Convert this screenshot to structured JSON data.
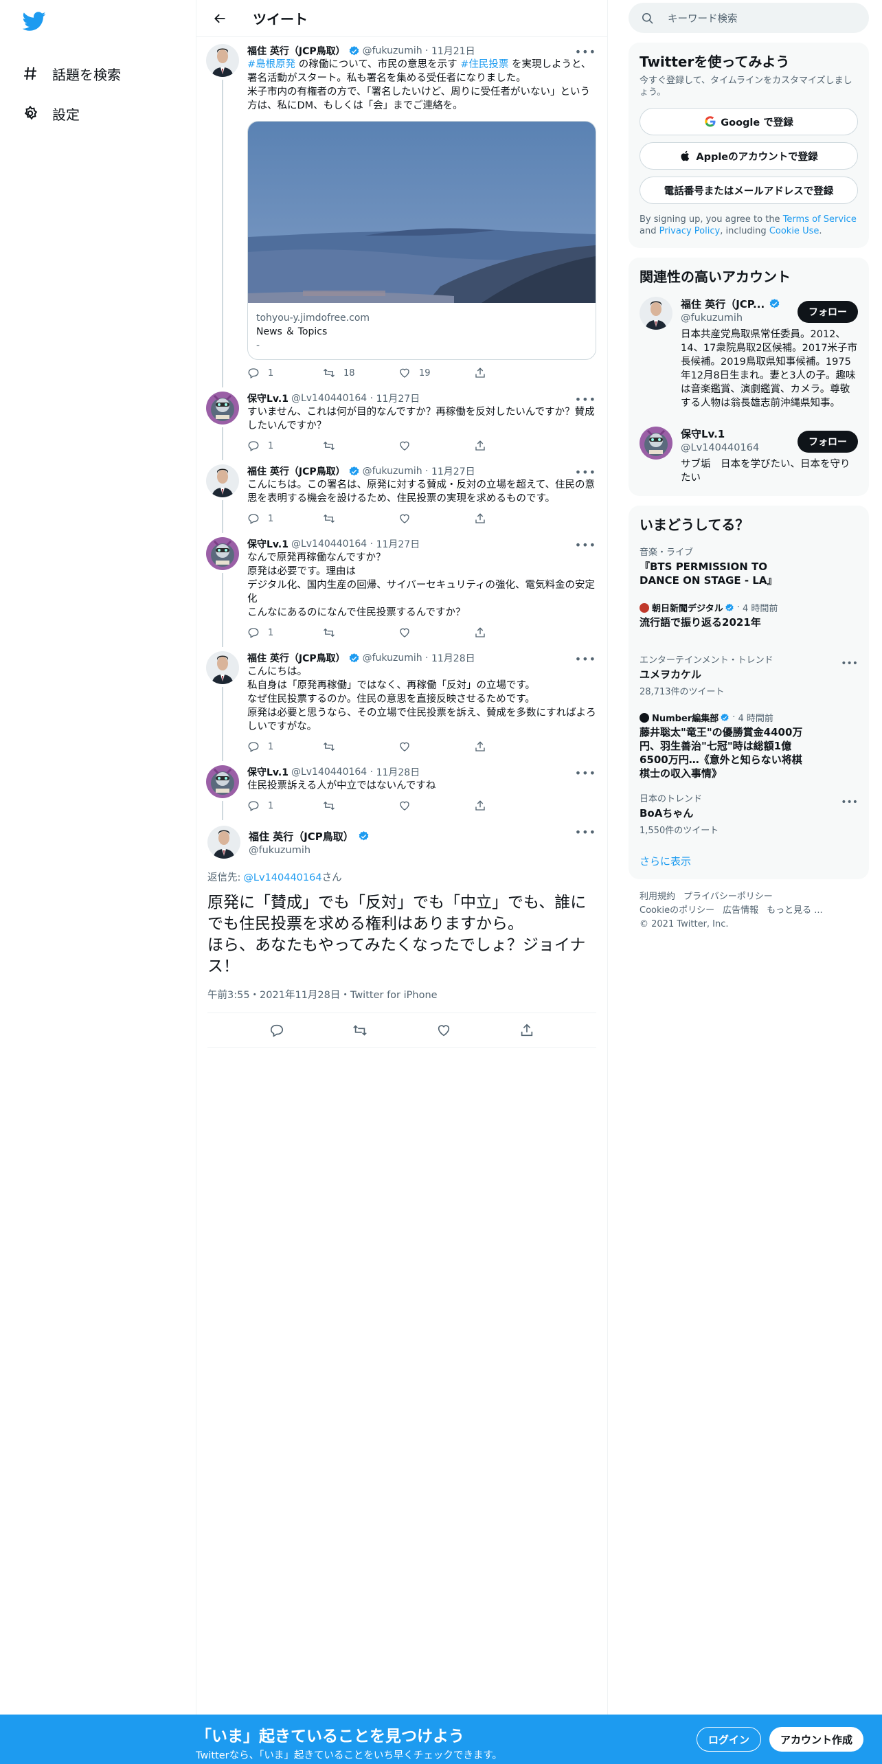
{
  "nav": {
    "explore_label": "話題を検索",
    "settings_label": "設定"
  },
  "header": {
    "title": "ツイート"
  },
  "tweets": [
    {
      "name": "福住 英行（JCP鳥取）",
      "verified": true,
      "handle": "@fukuzumih",
      "date": "11月21日",
      "hashtag1": "#島根原発",
      "text_a": " の稼働について、市民の意思を示す ",
      "hashtag2": "#住民投票",
      "text_b": " を実現しようと、署名活動がスタート。私も署名を集める受任者になりました。\n米子市内の有権者の方で、「署名したいけど、周りに受任者がいない」という方は、私にDM、もしくは「会」までご連絡を。",
      "card_domain": "tohyou-y.jimdofree.com",
      "card_title": "News ＆ Topics",
      "card_desc": "-",
      "replies": "1",
      "retweets": "18",
      "likes": "19"
    },
    {
      "name": "保守Lv.1",
      "handle": "@Lv140440164",
      "date": "11月27日",
      "text": "すいません、これは何が目的なんですか？再稼働を反対したいんですか？賛成したいんですか？",
      "replies": "1"
    },
    {
      "name": "福住 英行（JCP鳥取）",
      "handle": "@fukuzumih",
      "date": "11月27日",
      "text": "こんにちは。この署名は、原発に対する賛成・反対の立場を超えて、住民の意思を表明する機会を設けるため、住民投票の実現を求めるものです。",
      "replies": "1"
    },
    {
      "name": "保守Lv.1",
      "handle": "@Lv140440164",
      "date": "11月27日",
      "text": "なんで原発再稼働なんですか？\n原発は必要です。理由は\nデジタル化、国内生産の回帰、サイバーセキュリティの強化、電気料金の安定化\nこんなにあるのになんで住民投票するんですか？",
      "replies": "1"
    },
    {
      "name": "福住 英行（JCP鳥取）",
      "handle": "@fukuzumih",
      "date": "11月28日",
      "text": "こんにちは。\n私自身は「原発再稼働」ではなく、再稼働「反対」の立場です。\nなぜ住民投票するのか。住民の意思を直接反映させるためです。\n原発は必要と思うなら、その立場で住民投票を訴え、賛成を多数にすればよろしいですがな。",
      "replies": "1"
    },
    {
      "name": "保守Lv.1",
      "handle": "@Lv140440164",
      "date": "11月28日",
      "text": "住民投票訴える人が中立ではないんですね",
      "replies": "1"
    }
  ],
  "focused": {
    "name": "福住 英行（JCP鳥取）",
    "handle": "@fukuzumih",
    "reply_prefix": "返信先:",
    "reply_handle": "@Lv140440164",
    "reply_suffix": "さん",
    "text": "原発に「賛成」でも「反対」でも「中立」でも、誰にでも住民投票を求める権利はありますから。\nほら、あなたもやってみたくなったでしょ？ジョイナス！",
    "time": "午前3:55・2021年11月28日・Twitter for iPhone"
  },
  "search": {
    "placeholder": "キーワード検索"
  },
  "signup": {
    "title": "Twitterを使ってみよう",
    "subtitle": "今すぐ登録して、タイムラインをカスタマイズしましょう。",
    "google": "Google で登録",
    "apple": "Appleのアカウントで登録",
    "phone": "電話番号またはメールアドレスで登録",
    "terms_a": "By signing up, you agree to the ",
    "terms_link1": "Terms of Service",
    "terms_b": " and ",
    "terms_link2": "Privacy Policy",
    "terms_c": ", including ",
    "terms_link3": "Cookie Use",
    "terms_d": "."
  },
  "related": {
    "title": "関連性の高いアカウント",
    "accounts": [
      {
        "name": "福住 英行（JCP...",
        "handle": "@fukuzumih",
        "follow": "フォロー",
        "bio": "日本共産党鳥取県常任委員。2012、14、17衆院鳥取2区候補。2017米子市長候補。2019鳥取県知事候補。1975年12月8日生まれ。妻と3人の子。趣味は音楽鑑賞、演劇鑑賞、カメラ。尊敬する人物は翁長雄志前沖縄県知事。"
      },
      {
        "name": "保守Lv.1",
        "handle": "@Lv140440164",
        "follow": "フォロー",
        "bio": "サブ垢　日本を学びたい、日本を守りたい"
      }
    ]
  },
  "trends": {
    "title": "いまどうしてる？",
    "items": [
      {
        "category": "音楽・ライブ",
        "title": "『BTS PERMISSION TO DANCE ON STAGE - LA』"
      },
      {
        "source": "朝日新聞デジタル",
        "time": "4 時間前",
        "title": "流行語で振り返る2021年"
      },
      {
        "category": "エンターテインメント・トレンド",
        "title": "ユメヲカケル",
        "count": "28,713件のツイート"
      },
      {
        "source": "Number編集部",
        "time": "4 時間前",
        "title": "藤井聡太\"竜王\"の優勝賞金4400万円、羽生善治\"七冠\"時は総額1億6500万円…《意外と知らない将棋棋士の収入事情》"
      },
      {
        "category": "日本のトレンド",
        "title": "BoAちゃん",
        "count": "1,550件のツイート"
      }
    ],
    "more": "さらに表示"
  },
  "footer": {
    "links": [
      "利用規約",
      "プライバシーポリシー",
      "Cookieのポリシー",
      "広告情報",
      "もっと見る ..."
    ],
    "copyright": "© 2021 Twitter, Inc."
  },
  "bottom": {
    "title": "「いま」起きていることを見つけよう",
    "subtitle": "Twitterなら、「いま」起きていることをいち早くチェックできます。",
    "login": "ログイン",
    "signup": "アカウント作成"
  },
  "colors": {
    "accent": "#1d9bf0",
    "text": "#0f1419",
    "muted": "#536471"
  }
}
